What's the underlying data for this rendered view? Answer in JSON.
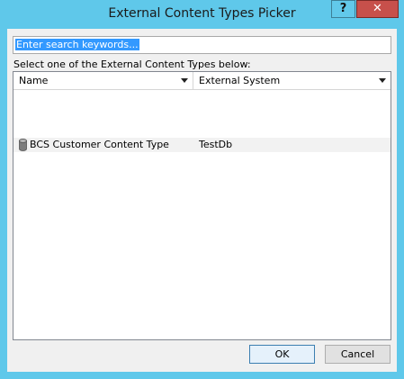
{
  "window": {
    "title": "External Content Types Picker",
    "help_label": "?",
    "close_label": "✕"
  },
  "search": {
    "value": "Enter search keywords..."
  },
  "instruction": "Select one of the External Content Types below:",
  "list": {
    "columns": [
      "Name",
      "External System"
    ],
    "rows": [
      {
        "name": "BCS Customer Content Type",
        "system": "TestDb",
        "icon": "database-icon"
      }
    ]
  },
  "buttons": {
    "ok": "OK",
    "cancel": "Cancel"
  },
  "colors": {
    "frame": "#5fc8ea",
    "close": "#c7504b",
    "selection": "#3399ff"
  }
}
